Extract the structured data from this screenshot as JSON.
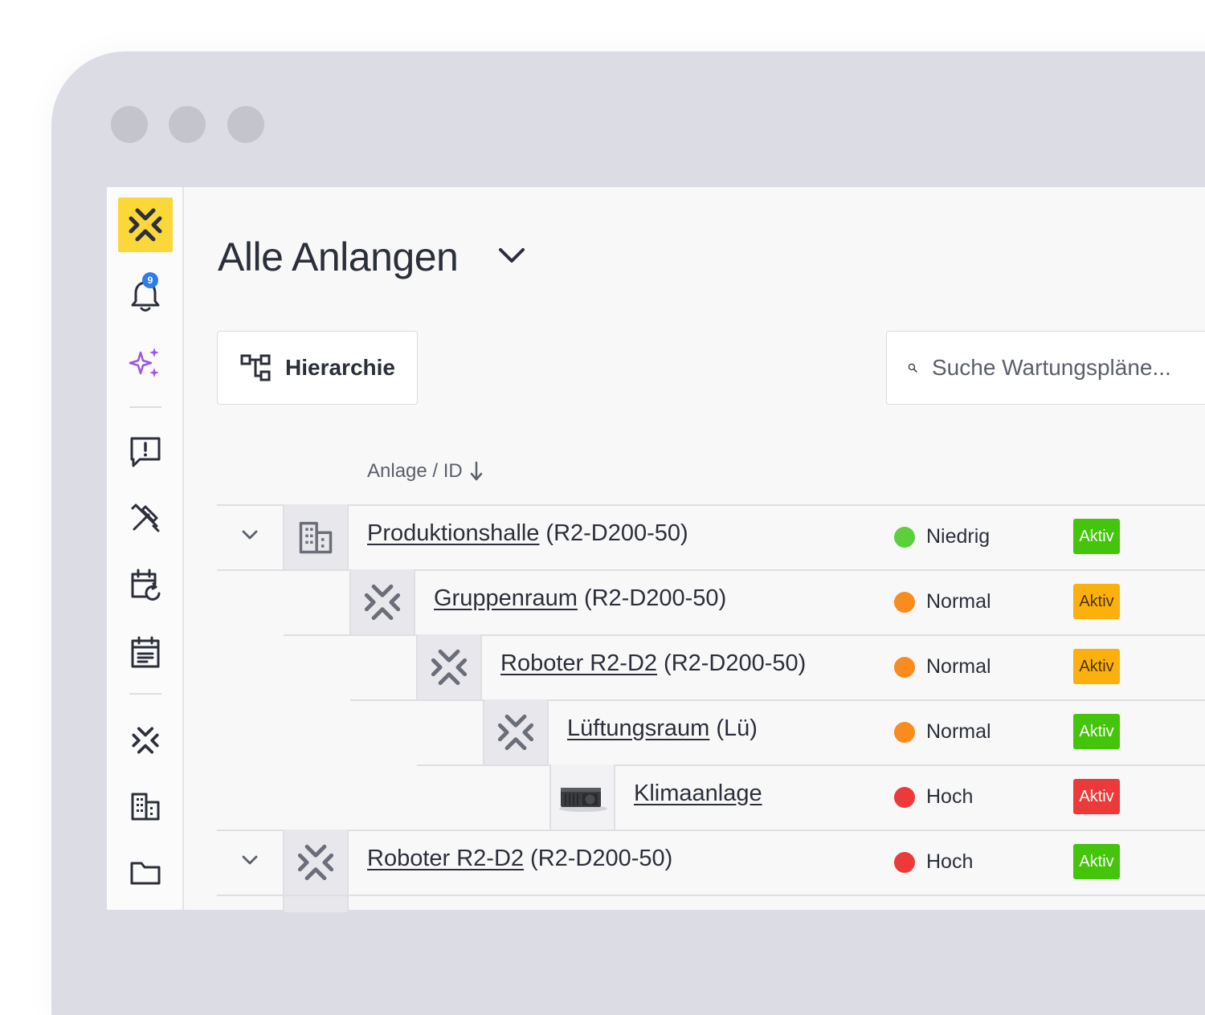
{
  "page": {
    "title": "Alle Anlangen",
    "hierarchy_button": "Hierarchie",
    "search_placeholder": "Suche Wartungspläne...",
    "column_header": "Anlage / ID"
  },
  "sidebar": {
    "notification_count": "9",
    "items": [
      "logo",
      "notifications",
      "ai-sparkles",
      "reports",
      "tools",
      "recurring-calendar",
      "calendar",
      "assets",
      "buildings",
      "folders"
    ]
  },
  "rows": [
    {
      "name": "Produktionshalle",
      "id": "(R2-D200-50)",
      "icon": "building-icon",
      "priority": "Niedrig",
      "priority_color": "#5ccf3d",
      "status": "Aktiv",
      "status_color": "#44c40a",
      "status_text_color": "#ffffff",
      "expanded": true
    },
    {
      "name": "Gruppenraum",
      "id": "(R2-D200-50)",
      "icon": "asset-x-icon",
      "priority": "Normal",
      "priority_color": "#fa8b1e",
      "status": "Aktiv",
      "status_color": "#fbb00e",
      "status_text_color": "#4a3500"
    },
    {
      "name": "Roboter R2-D2",
      "id": "(R2-D200-50)",
      "icon": "asset-x-icon",
      "priority": "Normal",
      "priority_color": "#fa8b1e",
      "status": "Aktiv",
      "status_color": "#fbb00e",
      "status_text_color": "#4a3500"
    },
    {
      "name": "Lüftungsraum",
      "id": "(Lü)",
      "icon": "asset-x-icon",
      "priority": "Normal",
      "priority_color": "#fa8b1e",
      "status": "Aktiv",
      "status_color": "#44c40a",
      "status_text_color": "#ffffff"
    },
    {
      "name": "Klimaanlage",
      "id": "",
      "icon": "air-conditioner-icon",
      "priority": "Hoch",
      "priority_color": "#ec3a3a",
      "status": "Aktiv",
      "status_color": "#ec3a3a",
      "status_text_color": "#ffffff"
    },
    {
      "name": "Roboter R2-D2",
      "id": "(R2-D200-50)",
      "icon": "asset-x-icon",
      "priority": "Hoch",
      "priority_color": "#ec3a3a",
      "status": "Aktiv",
      "status_color": "#44c40a",
      "status_text_color": "#ffffff",
      "expanded": true
    }
  ]
}
